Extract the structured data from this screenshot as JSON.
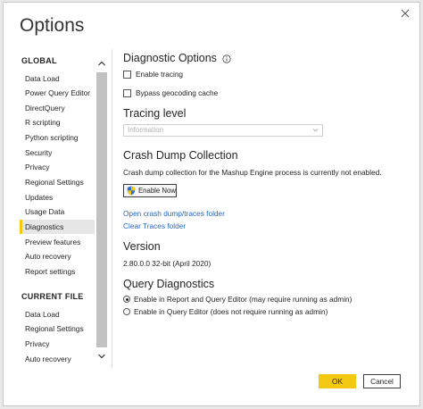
{
  "window": {
    "title": "Options"
  },
  "sidebar": {
    "global_heading": "GLOBAL",
    "global_items": [
      "Data Load",
      "Power Query Editor",
      "DirectQuery",
      "R scripting",
      "Python scripting",
      "Security",
      "Privacy",
      "Regional Settings",
      "Updates",
      "Usage Data",
      "Diagnostics",
      "Preview features",
      "Auto recovery",
      "Report settings"
    ],
    "active_item": "Diagnostics",
    "current_file_heading": "CURRENT FILE",
    "current_file_items": [
      "Data Load",
      "Regional Settings",
      "Privacy",
      "Auto recovery"
    ]
  },
  "diagnostic_options": {
    "heading": "Diagnostic Options",
    "enable_tracing_label": "Enable tracing",
    "bypass_geocoding_label": "Bypass geocoding cache"
  },
  "tracing_level": {
    "heading": "Tracing level",
    "selected": "Information"
  },
  "crash_dump": {
    "heading": "Crash Dump Collection",
    "status_text": "Crash dump collection for the Mashup Engine process is currently not enabled.",
    "enable_button_label": "Enable Now",
    "open_link": "Open crash dump/traces folder",
    "clear_link": "Clear Traces folder"
  },
  "version": {
    "heading": "Version",
    "value": "2.80.0.0 32-bit (April 2020)"
  },
  "query_diagnostics": {
    "heading": "Query Diagnostics",
    "option_1": "Enable in Report and Query Editor (may require running as admin)",
    "option_2": "Enable in Query Editor (does not require running as admin)"
  },
  "footer": {
    "ok_label": "OK",
    "cancel_label": "Cancel"
  },
  "colors": {
    "accent": "#f2c811",
    "link": "#2467c9",
    "text": "#252423"
  }
}
